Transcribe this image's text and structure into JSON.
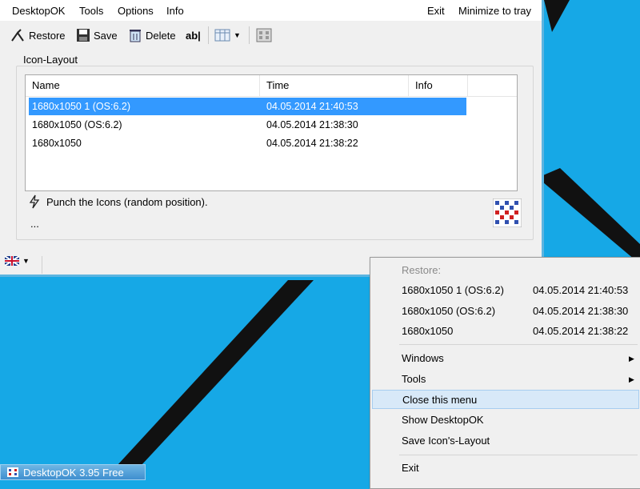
{
  "colors": {
    "desktop": "#16a8e6",
    "selection": "#3399ff",
    "menu_highlight": "#d8e9f8"
  },
  "menubar": {
    "app": "DesktopOK",
    "tools": "Tools",
    "options": "Options",
    "info": "Info",
    "exit": "Exit",
    "minimize": "Minimize to tray"
  },
  "toolbar": {
    "restore": "Restore",
    "save": "Save",
    "delete": "Delete",
    "text_icon": "ab|"
  },
  "group": {
    "title": "Icon-Layout"
  },
  "list": {
    "columns": [
      "Name",
      "Time",
      "Info"
    ],
    "rows": [
      {
        "name": "1680x1050 1 (OS:6.2)",
        "time": "04.05.2014 21:40:53"
      },
      {
        "name": "1680x1050 (OS:6.2)",
        "time": "04.05.2014 21:38:30"
      },
      {
        "name": "1680x1050",
        "time": "04.05.2014 21:38:22"
      }
    ]
  },
  "status": {
    "punch": "Punch the Icons (random position).",
    "more": "..."
  },
  "context_menu": {
    "restore_label": "Restore:",
    "entries": [
      {
        "name": "1680x1050 1 (OS:6.2)",
        "time": "04.05.2014 21:40:53"
      },
      {
        "name": "1680x1050 (OS:6.2)",
        "time": "04.05.2014 21:38:30"
      },
      {
        "name": "1680x1050",
        "time": "04.05.2014 21:38:22"
      }
    ],
    "windows": "Windows",
    "tools": "Tools",
    "close": "Close this menu",
    "show": "Show DesktopOK",
    "save": "Save Icon's-Layout",
    "exit": "Exit"
  },
  "taskbar": {
    "label": "DesktopOK 3.95 Free"
  }
}
